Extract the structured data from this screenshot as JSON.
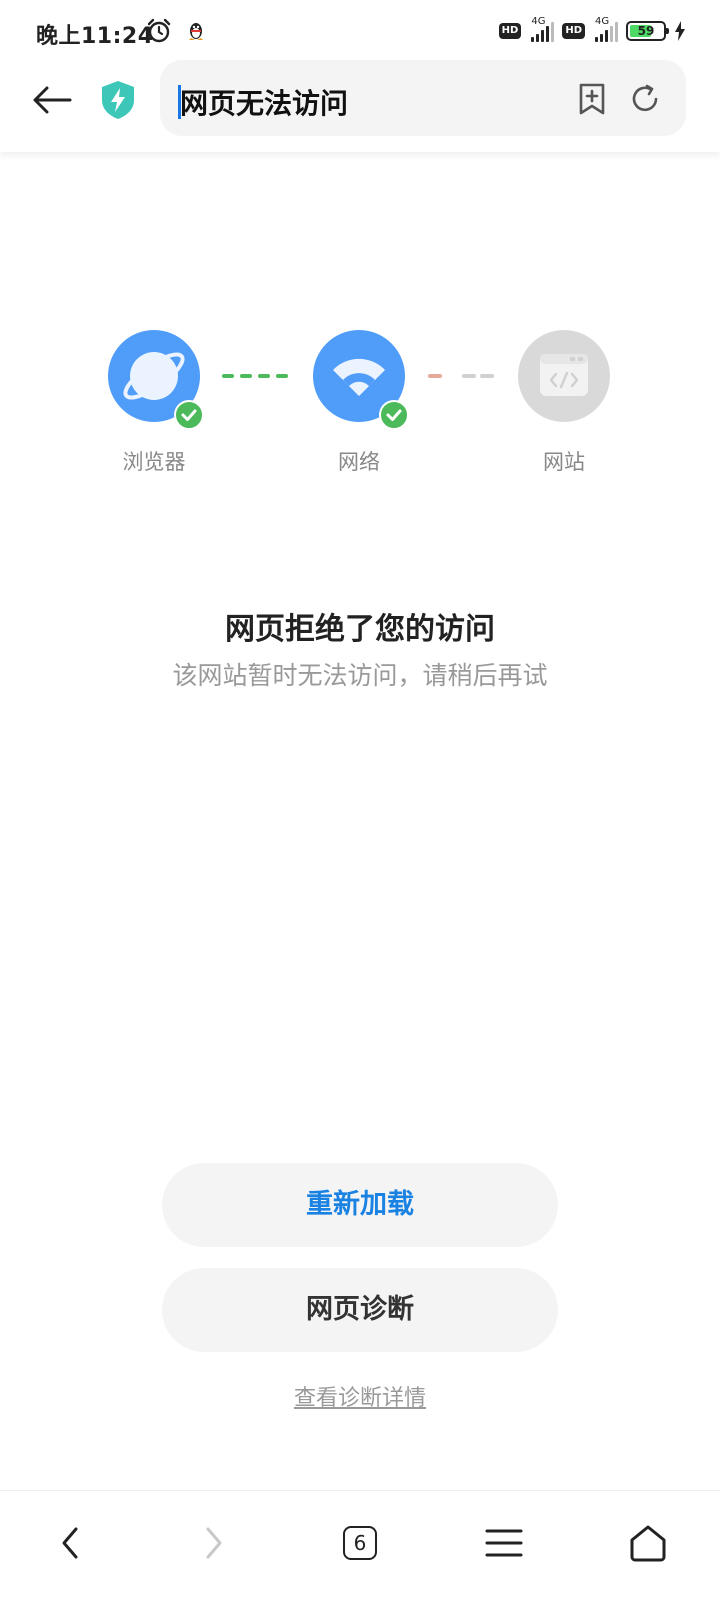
{
  "status_bar": {
    "time": "晚上11:24",
    "hd1": "HD",
    "hd2": "HD",
    "net1": "4G",
    "net2": "4G",
    "battery": "59"
  },
  "address_bar": {
    "text": "网页无法访问"
  },
  "diagnosis": {
    "steps": [
      {
        "label": "浏览器",
        "ok": true
      },
      {
        "label": "网络",
        "ok": true
      },
      {
        "label": "网站",
        "ok": false
      }
    ],
    "colors": {
      "ok": "#4cba5a",
      "node": "#4f9cf9",
      "fail_node": "#d9d9d9",
      "fail_dash": "#e8a898"
    }
  },
  "error": {
    "title": "网页拒绝了您的访问",
    "subtitle": "该网站暂时无法访问，请稍后再试"
  },
  "actions": {
    "reload": "重新加载",
    "diagnose": "网页诊断",
    "details": "查看诊断详情"
  },
  "bottom_nav": {
    "tab_count": "6"
  }
}
